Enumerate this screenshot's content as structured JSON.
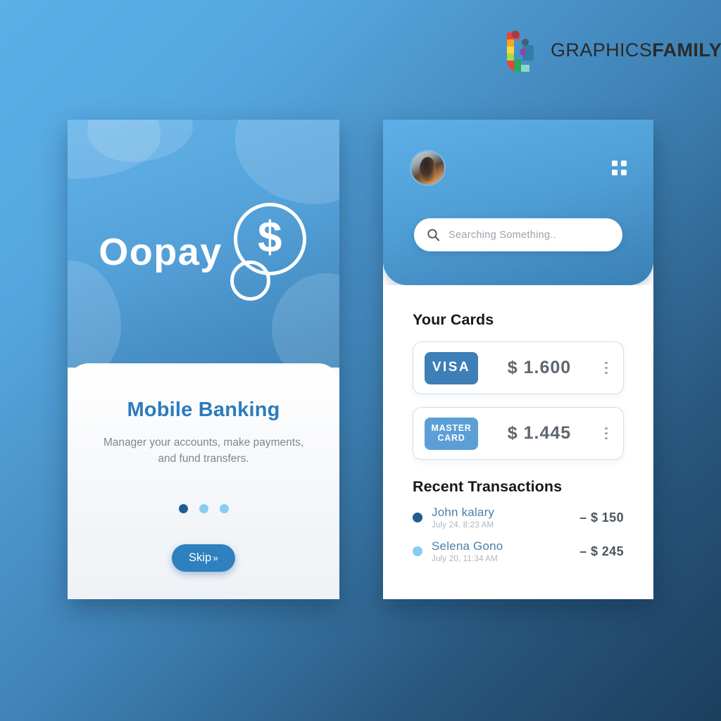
{
  "brand": {
    "logo_icon": "graphicsfamily-logo-icon",
    "name_light": "GRAPHICS",
    "name_bold": "FAMILY"
  },
  "colors": {
    "background_start": "#5BB0E8",
    "background_end": "#1C3F5D",
    "hero_blue": "#55A2DA",
    "accent_dark_blue": "#1E5D93",
    "accent_light_blue": "#86CDF2",
    "visa_badge": "#3D7FB6",
    "master_badge": "#5C9FD6",
    "title_blue": "#2C7BBE"
  },
  "onboarding_screen": {
    "app_name": "Oopay",
    "logo_symbol": "$",
    "title": "Mobile Banking",
    "description": "Manager your accounts, make payments, and fund transfers.",
    "pagination": {
      "total": 3,
      "active_index": 0
    },
    "skip_label": "Skip",
    "skip_chevron": "»"
  },
  "home_screen": {
    "avatar_icon": "user-avatar",
    "grid_menu_icon": "grid-menu-icon",
    "search": {
      "icon": "search-icon",
      "value": "",
      "placeholder": "Searching Something.."
    },
    "cards_section": {
      "title": "Your Cards",
      "cards": [
        {
          "brand": "VISA",
          "brand_line_1": "VISA",
          "brand_line_2": "",
          "amount": "$ 1.600",
          "menu_icon": "kebab-menu-icon"
        },
        {
          "brand": "MASTER CARD",
          "brand_line_1": "MASTER",
          "brand_line_2": "CARD",
          "amount": "$ 1.445",
          "menu_icon": "kebab-menu-icon"
        }
      ]
    },
    "transactions_section": {
      "title": "Recent Transactions",
      "transactions": [
        {
          "name": "John kalary",
          "date": "July 24, 8:23 AM",
          "amount": "– $ 150"
        },
        {
          "name": "Selena Gono",
          "date": "July 20, 11:34 AM",
          "amount": "– $ 245"
        }
      ]
    }
  }
}
